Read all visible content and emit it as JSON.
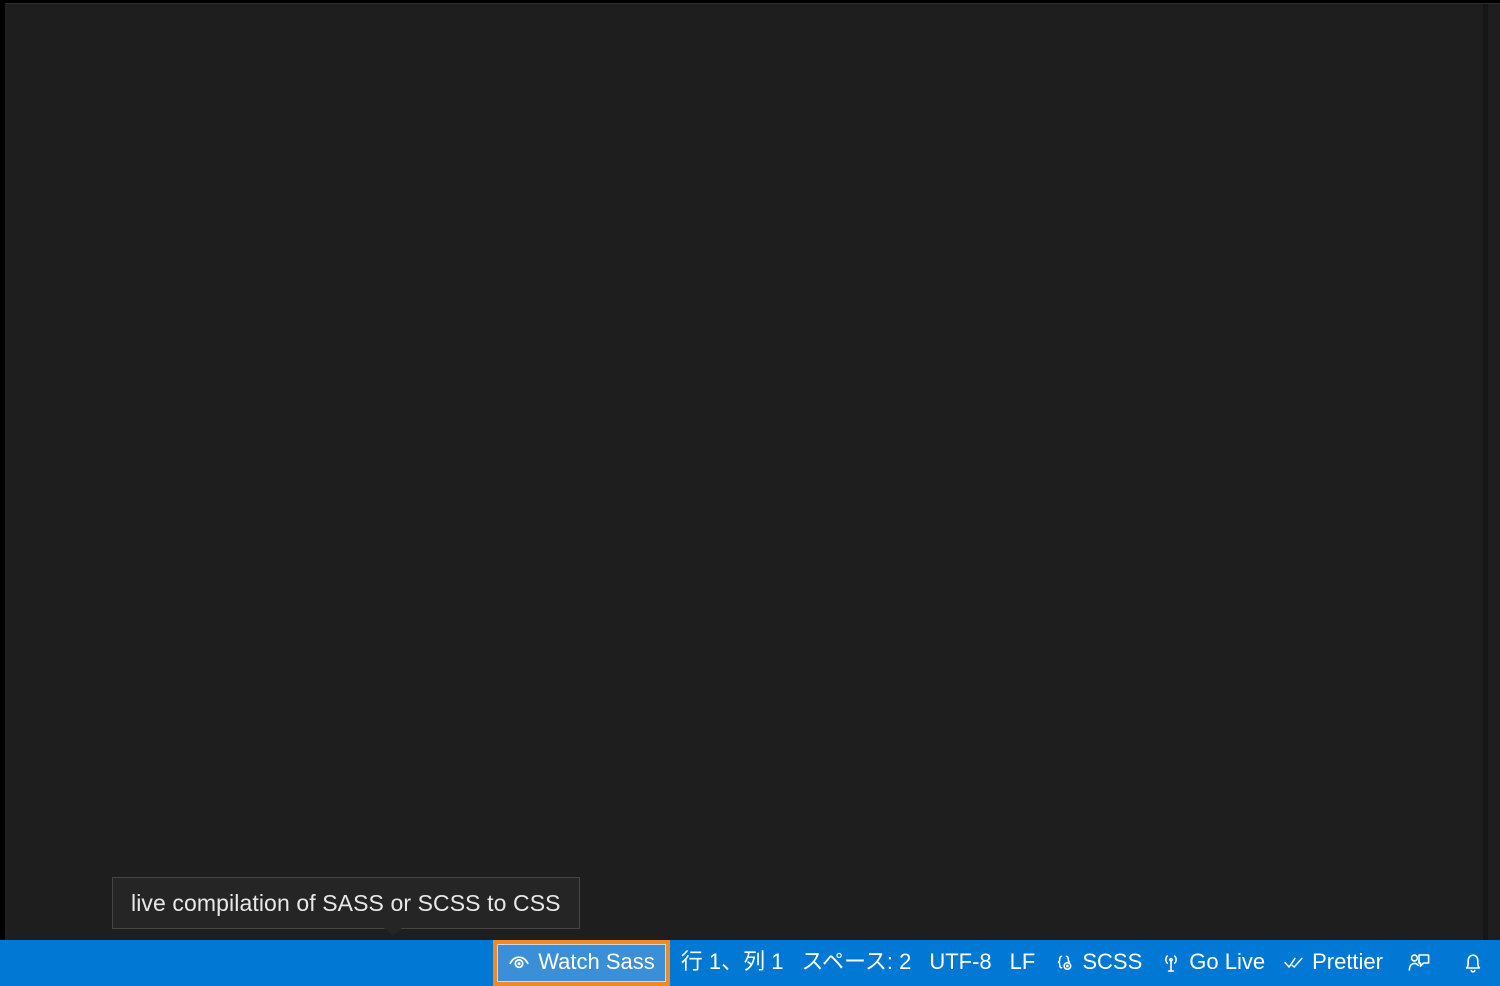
{
  "window": {
    "background_color": "#1e1e1e",
    "editor_empty": true
  },
  "tooltip": {
    "text": "live compilation of SASS or SCSS to CSS",
    "background_color": "#252526",
    "border_color": "#454545"
  },
  "statusbar": {
    "background_color": "#0078d4",
    "focus_border_color": "#ef8a26",
    "items": [
      {
        "name": "watch-sass",
        "icon": "eye-icon",
        "label": "Watch Sass",
        "focused": true
      },
      {
        "name": "cursor-position",
        "icon": "",
        "label": "行 1、列 1",
        "focused": false
      },
      {
        "name": "indentation",
        "icon": "",
        "label": "スペース: 2",
        "focused": false
      },
      {
        "name": "encoding",
        "icon": "",
        "label": "UTF-8",
        "focused": false
      },
      {
        "name": "end-of-line",
        "icon": "",
        "label": "LF",
        "focused": false
      },
      {
        "name": "language-mode",
        "icon": "braces-icon",
        "label": "SCSS",
        "focused": false
      },
      {
        "name": "go-live",
        "icon": "broadcast-icon",
        "label": "Go Live",
        "focused": false
      },
      {
        "name": "prettier",
        "icon": "double-check-icon",
        "label": "Prettier",
        "focused": false
      },
      {
        "name": "feedback",
        "icon": "feedback-person-icon",
        "label": "",
        "focused": false
      },
      {
        "name": "notifications",
        "icon": "bell-icon",
        "label": "",
        "focused": false
      }
    ]
  }
}
